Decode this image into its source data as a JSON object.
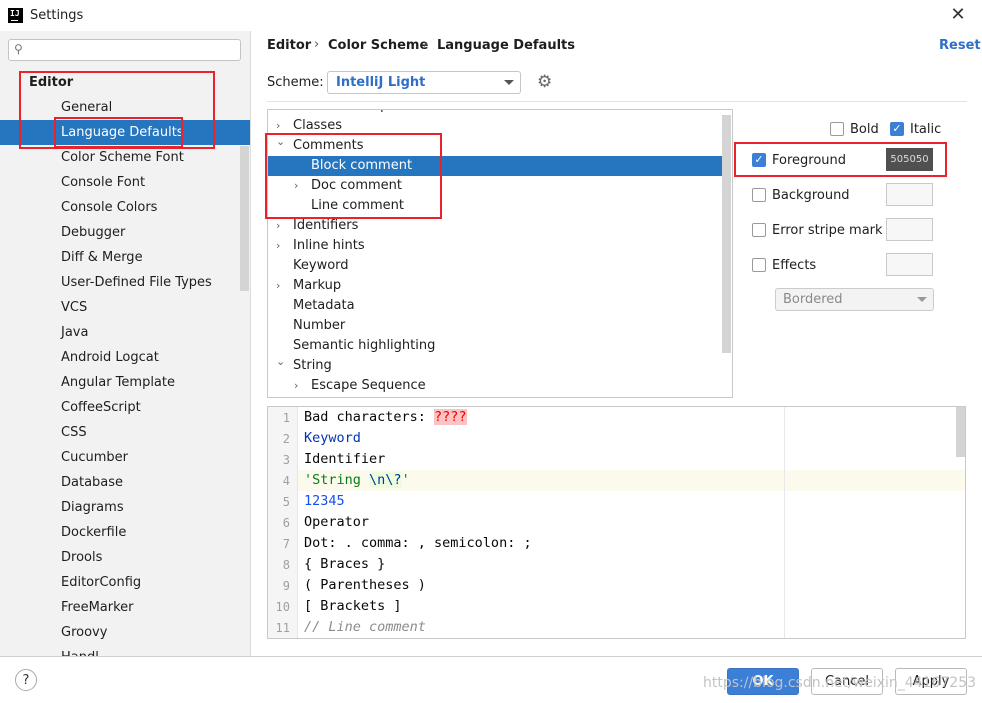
{
  "window": {
    "title": "Settings",
    "app_icon_text": "IJ",
    "close_glyph": "✕"
  },
  "search": {
    "placeholder": ""
  },
  "sidebar": {
    "items": [
      {
        "label": "Editor",
        "level": 0
      },
      {
        "label": "General",
        "level": 1
      },
      {
        "label": "Language Defaults",
        "level": 1,
        "selected": true
      },
      {
        "label": "Color Scheme Font",
        "level": 1
      },
      {
        "label": "Console Font",
        "level": 1
      },
      {
        "label": "Console Colors",
        "level": 1
      },
      {
        "label": "Debugger",
        "level": 1
      },
      {
        "label": "Diff & Merge",
        "level": 1
      },
      {
        "label": "User-Defined File Types",
        "level": 1
      },
      {
        "label": "VCS",
        "level": 1
      },
      {
        "label": "Java",
        "level": 1
      },
      {
        "label": "Android Logcat",
        "level": 1
      },
      {
        "label": "Angular Template",
        "level": 1
      },
      {
        "label": "CoffeeScript",
        "level": 1
      },
      {
        "label": "CSS",
        "level": 1
      },
      {
        "label": "Cucumber",
        "level": 1
      },
      {
        "label": "Database",
        "level": 1
      },
      {
        "label": "Diagrams",
        "level": 1
      },
      {
        "label": "Dockerfile",
        "level": 1
      },
      {
        "label": "Drools",
        "level": 1
      },
      {
        "label": "EditorConfig",
        "level": 1
      },
      {
        "label": "FreeMarker",
        "level": 1
      },
      {
        "label": "Groovy",
        "level": 1
      },
      {
        "label": "Handl",
        "level": 1
      }
    ]
  },
  "breadcrumb": [
    "Editor",
    "Color Scheme",
    "Language Defaults"
  ],
  "breadcrumb_sep": "›",
  "reset_label": "Reset",
  "scheme": {
    "label": "Scheme:",
    "value": "IntelliJ Light"
  },
  "tree": {
    "items": [
      {
        "label": "Braces and Operators",
        "level": 0,
        "chevron": "right"
      },
      {
        "label": "Classes",
        "level": 0,
        "chevron": "right"
      },
      {
        "label": "Comments",
        "level": 0,
        "chevron": "down"
      },
      {
        "label": "Block comment",
        "level": 1,
        "chevron": "",
        "selected": true
      },
      {
        "label": "Doc comment",
        "level": 1,
        "chevron": "right"
      },
      {
        "label": "Line comment",
        "level": 1,
        "chevron": ""
      },
      {
        "label": "Identifiers",
        "level": 0,
        "chevron": "right"
      },
      {
        "label": "Inline hints",
        "level": 0,
        "chevron": "right"
      },
      {
        "label": "Keyword",
        "level": 0,
        "chevron": ""
      },
      {
        "label": "Markup",
        "level": 0,
        "chevron": "right"
      },
      {
        "label": "Metadata",
        "level": 0,
        "chevron": ""
      },
      {
        "label": "Number",
        "level": 0,
        "chevron": ""
      },
      {
        "label": "Semantic highlighting",
        "level": 0,
        "chevron": ""
      },
      {
        "label": "String",
        "level": 0,
        "chevron": "down"
      },
      {
        "label": "Escape Sequence",
        "level": 1,
        "chevron": "right"
      }
    ]
  },
  "attributes": {
    "bold": {
      "label": "Bold",
      "checked": false
    },
    "italic": {
      "label": "Italic",
      "checked": true
    },
    "foreground": {
      "label": "Foreground",
      "checked": true,
      "value": "505050"
    },
    "background": {
      "label": "Background",
      "checked": false
    },
    "error_stripe": {
      "label": "Error stripe mark",
      "checked": false
    },
    "effects": {
      "label": "Effects",
      "checked": false
    },
    "effect_type": "Bordered",
    "check_glyph": "✓"
  },
  "preview": {
    "line_numbers": [
      "1",
      "2",
      "3",
      "4",
      "5",
      "6",
      "7",
      "8",
      "9",
      "10",
      "11"
    ],
    "lines": {
      "l1_text": "Bad characters: ",
      "l1_bad": "????",
      "l2": "Keyword",
      "l3": "Identifier",
      "l4_str": "'String ",
      "l4_esc1": "\\n",
      "l4_esc2": "\\?",
      "l4_end": "'",
      "l5": "12345",
      "l6": "Operator",
      "l7": "Dot: . comma: , semicolon: ;",
      "l8": "{ Braces }",
      "l9": "( Parentheses )",
      "l10": "[ Brackets ]",
      "l11": "// Line comment"
    }
  },
  "buttons": {
    "help": "?",
    "ok": "OK",
    "cancel": "Cancel",
    "apply": "Apply"
  },
  "watermark": "https://blog.csdn.net/weixin_44167253",
  "colors": {
    "accent": "#2675bf",
    "link": "#2f6fc7",
    "annotation_red": "#e8232b",
    "foreground_swatch": "#505050"
  }
}
